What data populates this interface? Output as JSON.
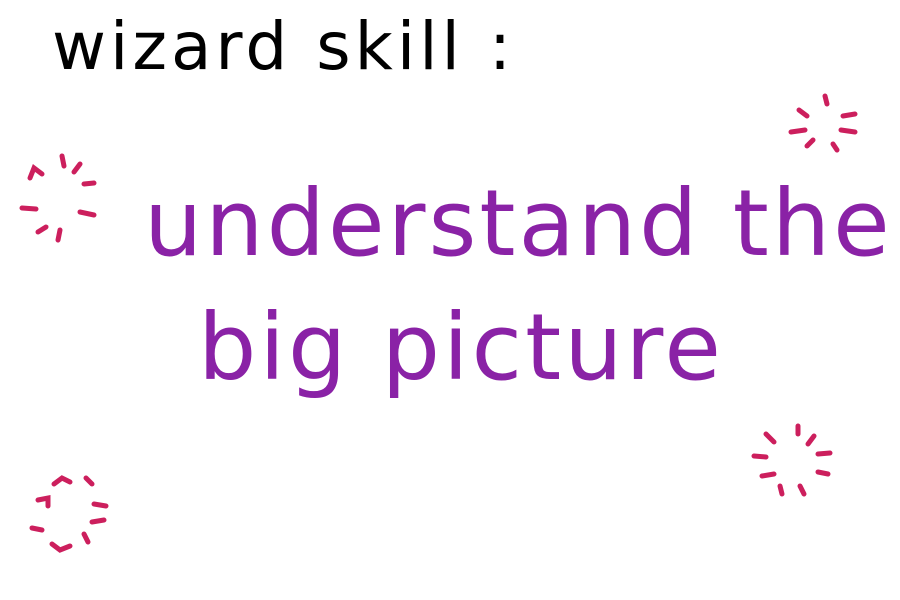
{
  "heading": "wizard skill :",
  "message": {
    "line1": "understand the",
    "line2": "big picture"
  },
  "colors": {
    "background": "#ffffff",
    "heading": "#000000",
    "message": "#8a22a6",
    "sparkle": "#cc1f5d"
  },
  "decorations": [
    "sparkle-icon",
    "sparkle-icon",
    "sparkle-icon",
    "sparkle-icon"
  ]
}
